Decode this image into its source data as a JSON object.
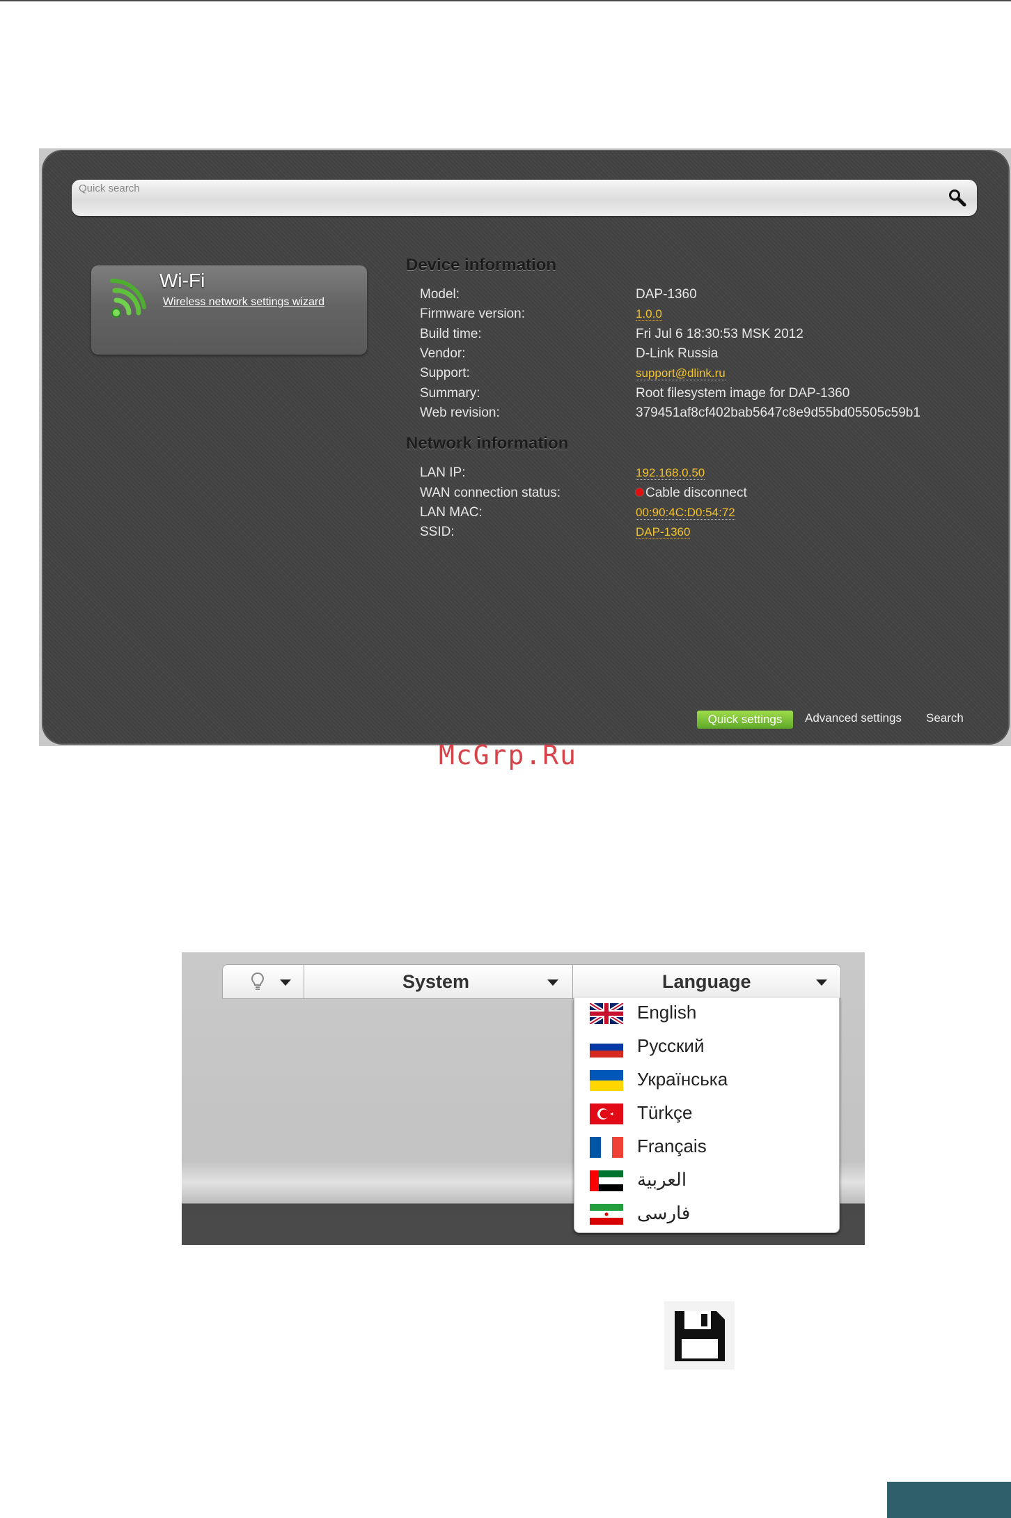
{
  "dashboard": {
    "search_placeholder": "Quick search",
    "wifi_card": {
      "title": "Wi-Fi",
      "link": "Wireless network settings wizard"
    },
    "device_info": {
      "title": "Device information",
      "rows": [
        {
          "label": "Model:",
          "value": "DAP-1360"
        },
        {
          "label": "Firmware version:",
          "value": "1.0.0"
        },
        {
          "label": "Build time:",
          "value": "Fri Jul 6 18:30:53 MSK 2012"
        },
        {
          "label": "Vendor:",
          "value": "D-Link Russia"
        },
        {
          "label": "Support:",
          "value": "support@dlink.ru"
        },
        {
          "label": "Summary:",
          "value": "Root filesystem image for DAP-1360"
        },
        {
          "label": "Web revision:",
          "value": "379451af8cf402bab5647c8e9d55bd05505c59b1"
        }
      ]
    },
    "network_info": {
      "title": "Network information",
      "rows": [
        {
          "label": "LAN IP:",
          "value": "192.168.0.50"
        },
        {
          "label": "WAN connection status:",
          "value": "Cable disconnect"
        },
        {
          "label": "LAN MAC:",
          "value": "00:90:4C:D0:54:72"
        },
        {
          "label": "SSID:",
          "value": "DAP-1360"
        }
      ]
    },
    "bottom_nav": {
      "quick": "Quick settings",
      "advanced": "Advanced settings",
      "search": "Search"
    },
    "colors": {
      "link": "#f2c12e",
      "accent_green": "#6fb832",
      "status_red": "#e01010"
    }
  },
  "watermark": "McGrp.Ru",
  "menu": {
    "tabs": {
      "bulb_icon": "lightbulb-icon",
      "system": "System",
      "language": "Language"
    },
    "languages": [
      {
        "flag": "uk-flag",
        "label": "English"
      },
      {
        "flag": "ru-flag",
        "label": "Русский"
      },
      {
        "flag": "ua-flag",
        "label": "Українська"
      },
      {
        "flag": "tr-flag",
        "label": "Türkçe"
      },
      {
        "flag": "fr-flag",
        "label": "Français"
      },
      {
        "flag": "ae-flag",
        "label": "العربية"
      },
      {
        "flag": "ir-flag",
        "label": "فارسی"
      }
    ]
  },
  "save_icon": "floppy-disk-icon"
}
